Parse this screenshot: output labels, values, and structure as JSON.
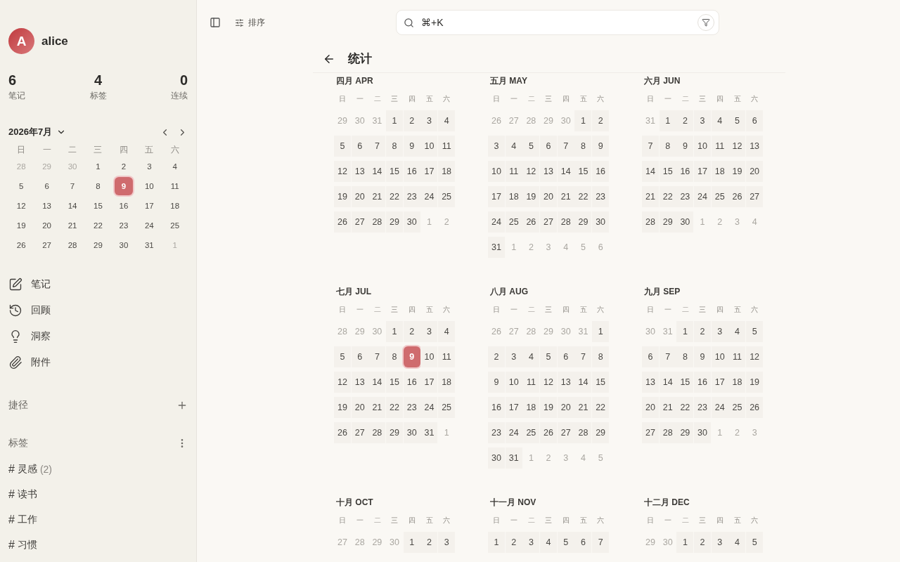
{
  "sidebar": {
    "user": {
      "initial": "A",
      "name": "alice"
    },
    "stats": [
      {
        "value": "6",
        "label": "笔记"
      },
      {
        "value": "4",
        "label": "标签"
      },
      {
        "value": "0",
        "label": "连续"
      }
    ],
    "calendar": {
      "title": "2026年7月",
      "weekdays": [
        "日",
        "一",
        "二",
        "三",
        "四",
        "五",
        "六"
      ],
      "leading": [
        "28",
        "29",
        "30"
      ],
      "days": [
        "1",
        "2",
        "3",
        "4",
        "5",
        "6",
        "7",
        "8",
        {
          "label": "9",
          "today": true
        },
        "10",
        "11",
        "12",
        "13",
        "14",
        "15",
        "16",
        "17",
        "18",
        "19",
        "20",
        "21",
        "22",
        "23",
        "24",
        "25",
        "26",
        "27",
        "28",
        "29",
        "30",
        "31"
      ],
      "trailing": [
        "1"
      ]
    },
    "nav": [
      {
        "label": "笔记"
      },
      {
        "label": "回顾"
      },
      {
        "label": "洞察"
      },
      {
        "label": "附件"
      }
    ],
    "shortcuts": {
      "title": "捷径"
    },
    "tags": {
      "title": "标签",
      "items": [
        {
          "hash": "#",
          "name": "灵感",
          "count": "(2)"
        },
        {
          "hash": "#",
          "name": "读书"
        },
        {
          "hash": "#",
          "name": "工作"
        },
        {
          "hash": "#",
          "name": "习惯"
        }
      ]
    }
  },
  "toolbar": {
    "sort": "排序",
    "search": {
      "placeholder": "⌘+K"
    }
  },
  "page": {
    "title": "统计",
    "months": [
      {
        "title": "四月 APR",
        "weekdays": [
          "日",
          "一",
          "二",
          "三",
          "四",
          "五",
          "六"
        ],
        "leading": [
          "29",
          "30",
          "31"
        ],
        "days": [
          "1",
          "2",
          "3",
          "4",
          "5",
          "6",
          "7",
          "8",
          "9",
          "10",
          "11",
          "12",
          "13",
          "14",
          "15",
          "16",
          "17",
          "18",
          "19",
          "20",
          "21",
          "22",
          "23",
          "24",
          "25",
          "26",
          "27",
          "28",
          "29",
          "30"
        ],
        "trailing": [
          "1",
          "2"
        ]
      },
      {
        "title": "五月 MAY",
        "weekdays": [
          "日",
          "一",
          "二",
          "三",
          "四",
          "五",
          "六"
        ],
        "leading": [
          "26",
          "27",
          "28",
          "29",
          "30"
        ],
        "days": [
          "1",
          "2",
          "3",
          "4",
          "5",
          "6",
          "7",
          "8",
          "9",
          "10",
          "11",
          "12",
          "13",
          "14",
          "15",
          "16",
          "17",
          "18",
          "19",
          "20",
          "21",
          "22",
          "23",
          "24",
          "25",
          "26",
          "27",
          "28",
          "29",
          "30",
          "31"
        ],
        "trailing": [
          "1",
          "2",
          "3",
          "4",
          "5",
          "6"
        ]
      },
      {
        "title": "六月 JUN",
        "weekdays": [
          "日",
          "一",
          "二",
          "三",
          "四",
          "五",
          "六"
        ],
        "leading": [
          "31"
        ],
        "days": [
          "1",
          "2",
          "3",
          "4",
          "5",
          "6",
          "7",
          "8",
          "9",
          "10",
          "11",
          "12",
          "13",
          "14",
          "15",
          "16",
          "17",
          "18",
          "19",
          "20",
          "21",
          "22",
          "23",
          "24",
          "25",
          "26",
          "27",
          "28",
          "29",
          "30"
        ],
        "trailing": [
          "1",
          "2",
          "3",
          "4"
        ]
      },
      {
        "title": "七月 JUL",
        "weekdays": [
          "日",
          "一",
          "二",
          "三",
          "四",
          "五",
          "六"
        ],
        "leading": [
          "28",
          "29",
          "30"
        ],
        "days": [
          "1",
          "2",
          "3",
          "4",
          "5",
          "6",
          "7",
          "8",
          {
            "label": "9",
            "today": true
          },
          "10",
          "11",
          "12",
          "13",
          "14",
          "15",
          "16",
          "17",
          "18",
          "19",
          "20",
          "21",
          "22",
          "23",
          "24",
          "25",
          "26",
          "27",
          "28",
          "29",
          "30",
          "31"
        ],
        "trailing": [
          "1"
        ]
      },
      {
        "title": "八月 AUG",
        "weekdays": [
          "日",
          "一",
          "二",
          "三",
          "四",
          "五",
          "六"
        ],
        "leading": [
          "26",
          "27",
          "28",
          "29",
          "30",
          "31"
        ],
        "days": [
          "1",
          "2",
          "3",
          "4",
          "5",
          "6",
          "7",
          "8",
          "9",
          "10",
          "11",
          "12",
          "13",
          "14",
          "15",
          "16",
          "17",
          "18",
          "19",
          "20",
          "21",
          "22",
          "23",
          "24",
          "25",
          "26",
          "27",
          "28",
          "29",
          "30",
          "31"
        ],
        "trailing": [
          "1",
          "2",
          "3",
          "4",
          "5"
        ]
      },
      {
        "title": "九月 SEP",
        "weekdays": [
          "日",
          "一",
          "二",
          "三",
          "四",
          "五",
          "六"
        ],
        "leading": [
          "30",
          "31"
        ],
        "days": [
          "1",
          "2",
          "3",
          "4",
          "5",
          "6",
          "7",
          "8",
          "9",
          "10",
          "11",
          "12",
          "13",
          "14",
          "15",
          "16",
          "17",
          "18",
          "19",
          "20",
          "21",
          "22",
          "23",
          "24",
          "25",
          "26",
          "27",
          "28",
          "29",
          "30"
        ],
        "trailing": [
          "1",
          "2",
          "3"
        ]
      },
      {
        "title": "十月 OCT",
        "weekdays": [
          "日",
          "一",
          "二",
          "三",
          "四",
          "五",
          "六"
        ],
        "leading": [
          "27",
          "28",
          "29",
          "30"
        ],
        "days": [
          "1",
          "2",
          "3"
        ]
      },
      {
        "title": "十一月 NOV",
        "weekdays": [
          "日",
          "一",
          "二",
          "三",
          "四",
          "五",
          "六"
        ],
        "days": [
          "1",
          "2",
          "3",
          "4",
          "5",
          "6",
          "7"
        ]
      },
      {
        "title": "十二月 DEC",
        "weekdays": [
          "日",
          "一",
          "二",
          "三",
          "四",
          "五",
          "六"
        ],
        "leading": [
          "29",
          "30"
        ],
        "days": [
          "1",
          "2",
          "3",
          "4",
          "5"
        ]
      }
    ]
  }
}
